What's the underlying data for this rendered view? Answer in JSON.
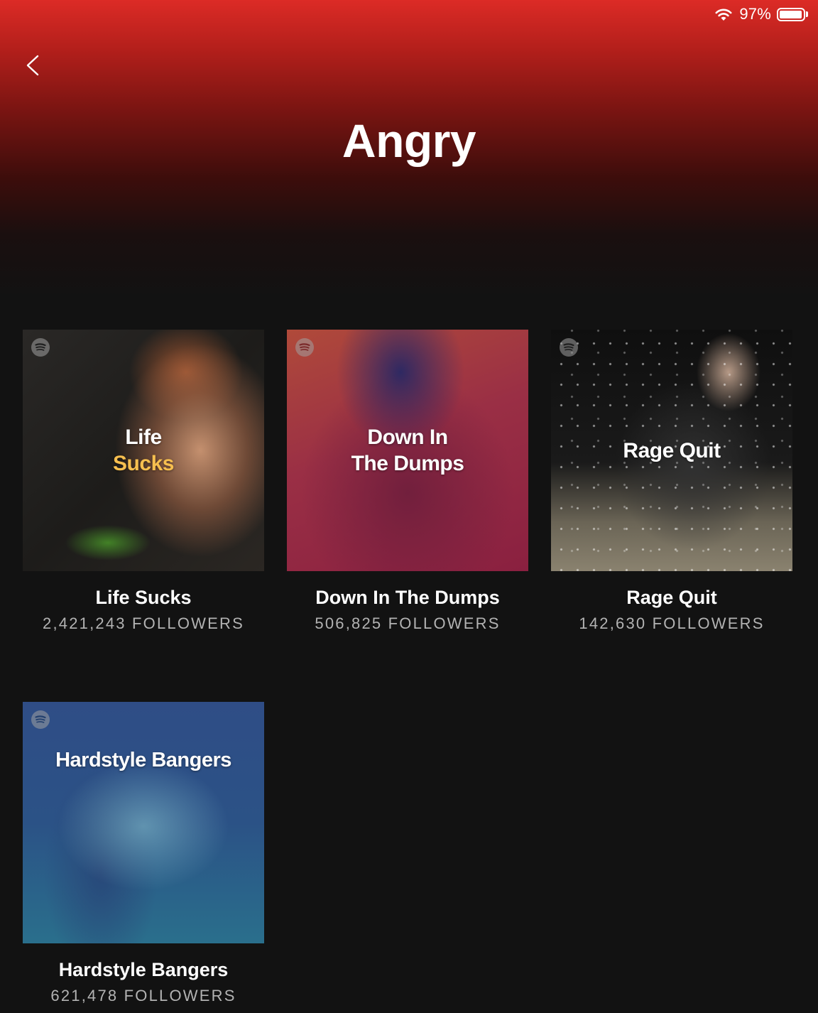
{
  "status_bar": {
    "battery_percent": "97%",
    "battery_level": 0.97,
    "icons": [
      "wifi-icon",
      "battery-icon"
    ]
  },
  "nav": {
    "back_icon": "chevron-left-icon"
  },
  "page": {
    "title": "Angry"
  },
  "colors": {
    "header_gradient_top": "#dc2b26",
    "background": "#121212",
    "followers_text": "#b3b3b3",
    "cover_accent_yellow": "#f6bf4f"
  },
  "playlists": [
    {
      "name": "Life Sucks",
      "cover_lines": [
        "Life",
        "Sucks"
      ],
      "followers_count": "2,421,243",
      "followers_label": "FOLLOWERS"
    },
    {
      "name": "Down In The Dumps",
      "cover_lines": [
        "Down In",
        "The Dumps"
      ],
      "followers_count": "506,825",
      "followers_label": "FOLLOWERS"
    },
    {
      "name": "Rage Quit",
      "cover_lines": [
        "Rage Quit"
      ],
      "followers_count": "142,630",
      "followers_label": "FOLLOWERS"
    },
    {
      "name": "Hardstyle Bangers",
      "cover_lines": [
        "Hardstyle Bangers"
      ],
      "followers_count": "621,478",
      "followers_label": "FOLLOWERS"
    }
  ]
}
